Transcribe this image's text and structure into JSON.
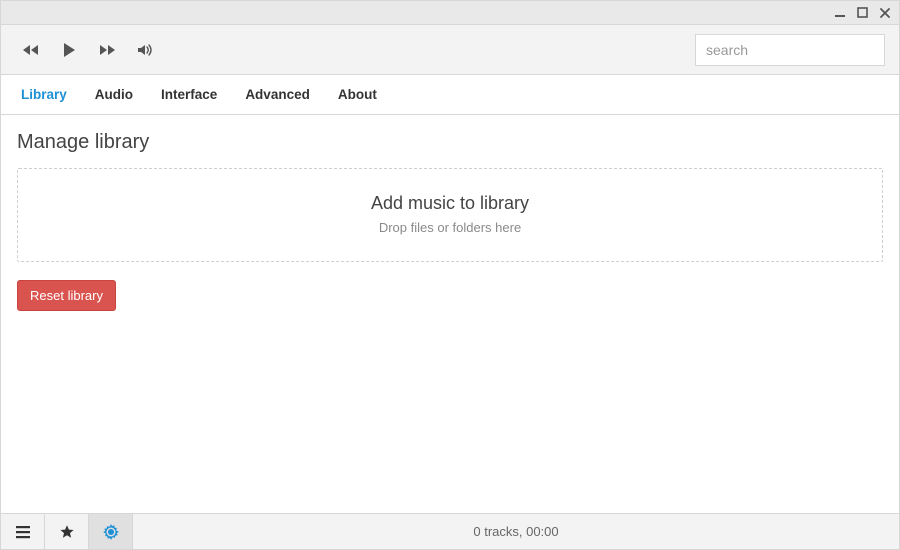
{
  "search": {
    "placeholder": "search",
    "value": ""
  },
  "tabs": [
    {
      "label": "Library",
      "active": true
    },
    {
      "label": "Audio"
    },
    {
      "label": "Interface"
    },
    {
      "label": "Advanced"
    },
    {
      "label": "About"
    }
  ],
  "page": {
    "heading": "Manage library",
    "dropzone_title": "Add music to library",
    "dropzone_subtitle": "Drop files or folders here",
    "reset_label": "Reset library"
  },
  "footer": {
    "status": "0 tracks, 00:00"
  },
  "icons": {
    "prev": "prev-icon",
    "play": "play-icon",
    "next": "next-icon",
    "volume": "volume-icon",
    "list": "list-icon",
    "star": "star-icon",
    "gear": "gear-icon",
    "minimize": "minimize-icon",
    "maximize": "maximize-icon",
    "close": "close-icon"
  }
}
